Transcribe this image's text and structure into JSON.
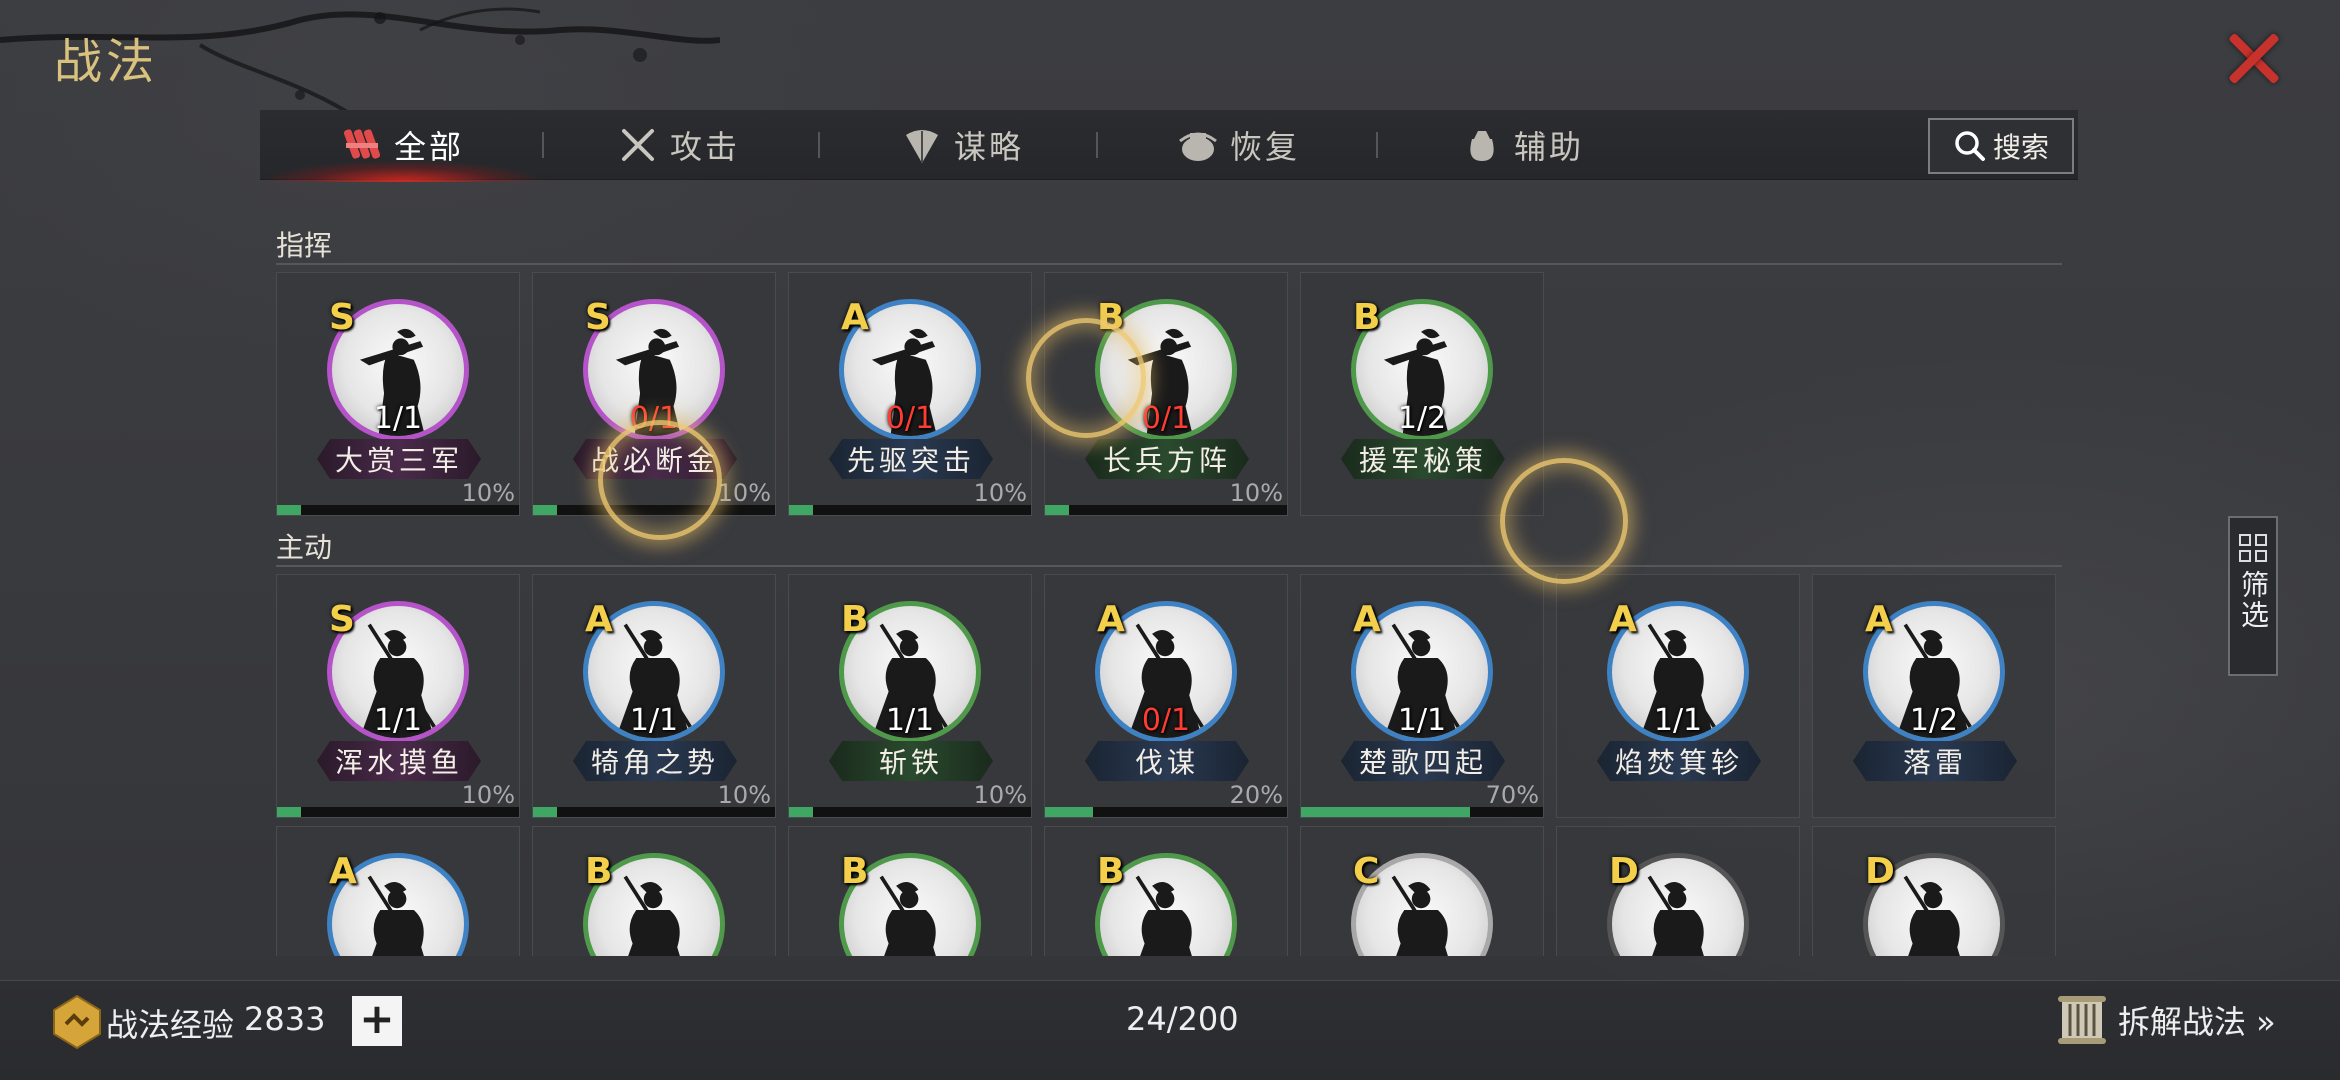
{
  "title": "战法",
  "tabs": [
    {
      "label": "全部",
      "icon": "scroll-bundle-icon",
      "active": true
    },
    {
      "label": "攻击",
      "icon": "crossed-swords-icon",
      "active": false
    },
    {
      "label": "谋略",
      "icon": "feather-fan-icon",
      "active": false
    },
    {
      "label": "恢复",
      "icon": "healing-pot-icon",
      "active": false
    },
    {
      "label": "辅助",
      "icon": "pouch-icon",
      "active": false
    }
  ],
  "search_label": "搜索",
  "sections": {
    "command": {
      "label": "指挥"
    },
    "active": {
      "label": "主动"
    }
  },
  "command_cards": [
    {
      "grade": "S",
      "count": "1/1",
      "count_red": false,
      "name": "大赏三军",
      "pct": "10%",
      "progress": 0.1
    },
    {
      "grade": "S",
      "count": "0/1",
      "count_red": true,
      "name": "战必断金",
      "pct": "10%",
      "progress": 0.1
    },
    {
      "grade": "A",
      "count": "0/1",
      "count_red": true,
      "name": "先驱突击",
      "pct": "10%",
      "progress": 0.1
    },
    {
      "grade": "B",
      "count": "0/1",
      "count_red": true,
      "name": "长兵方阵",
      "pct": "10%",
      "progress": 0.1
    },
    {
      "grade": "B",
      "count": "1/2",
      "count_red": false,
      "name": "援军秘策",
      "pct": "",
      "progress": 0
    }
  ],
  "active_cards": [
    {
      "grade": "S",
      "count": "1/1",
      "count_red": false,
      "name": "浑水摸鱼",
      "pct": "10%",
      "progress": 0.1
    },
    {
      "grade": "A",
      "count": "1/1",
      "count_red": false,
      "name": "犄角之势",
      "pct": "10%",
      "progress": 0.1
    },
    {
      "grade": "B",
      "count": "1/1",
      "count_red": false,
      "name": "斩铁",
      "pct": "10%",
      "progress": 0.1
    },
    {
      "grade": "A",
      "count": "0/1",
      "count_red": true,
      "name": "伐谋",
      "pct": "20%",
      "progress": 0.2
    },
    {
      "grade": "A",
      "count": "1/1",
      "count_red": false,
      "name": "楚歌四起",
      "pct": "70%",
      "progress": 0.7
    },
    {
      "grade": "A",
      "count": "1/1",
      "count_red": false,
      "name": "焰焚箕轸",
      "pct": "",
      "progress": 0
    },
    {
      "grade": "A",
      "count": "1/2",
      "count_red": false,
      "name": "落雷",
      "pct": "",
      "progress": 0
    }
  ],
  "more_cards": [
    {
      "grade": "A"
    },
    {
      "grade": "B"
    },
    {
      "grade": "B"
    },
    {
      "grade": "B"
    },
    {
      "grade": "C"
    },
    {
      "grade": "D"
    },
    {
      "grade": "D"
    }
  ],
  "filter_label": "筛选",
  "footer": {
    "exp_label": "战法经验",
    "exp_value": "2833",
    "plus": "+",
    "page_count": "24/200",
    "dismantle_label": "拆解战法 »"
  }
}
